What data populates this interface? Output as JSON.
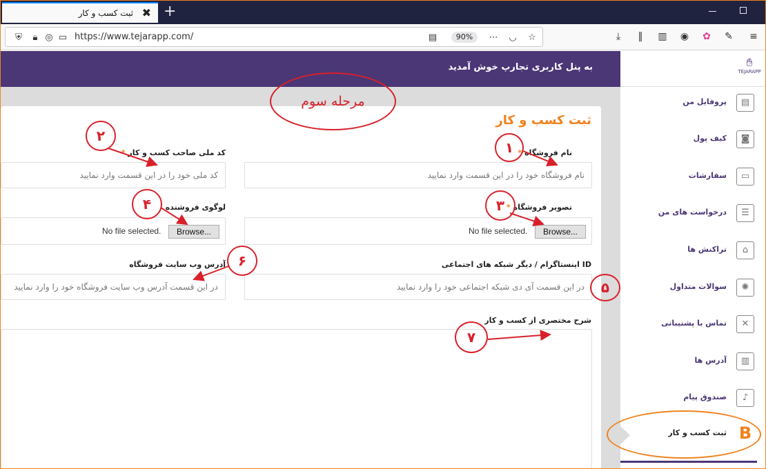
{
  "browser": {
    "tab_title": "ثبت کسب و کار",
    "tab_close": "✖",
    "new_tab": "+",
    "url": "https://www.tejarapp.com/",
    "zoom": "90%"
  },
  "header": {
    "welcome": "به پنل کاربری تجارپ خوش آمدید",
    "logo_text": "TEJARAPP"
  },
  "form": {
    "title": "ثبت کسب و کار",
    "required_mark": "*",
    "shop_name_label": "نام فروشگاه",
    "shop_name_placeholder": "نام فروشگاه خود را در این قسمت وارد نمایید",
    "national_code_label": "کد ملی صاحب کسب و کار",
    "national_code_placeholder": "کد ملی خود را در این قسمت وارد نمایید",
    "shop_image_label": "تصویر فروشگاه",
    "seller_logo_label": "لوگوی فروشنده",
    "browse_label": "Browse...",
    "no_file": "No file selected.",
    "social_label": "ID اینستاگرام / دیگر شبکه های اجتماعی",
    "social_placeholder": "در این قسمت آی دی شبکه اجتماعی خود را وارد نمایید",
    "website_label": "آدرس وب سایت فروشگاه",
    "website_placeholder": "در این قسمت آدرس وب سایت فروشگاه خود را وارد نمایید",
    "description_label": "شرح مختصری از کسب و کار"
  },
  "sidebar": {
    "items": [
      {
        "label": "پروفایل من",
        "icon": "id-card-icon",
        "glyph": "▤"
      },
      {
        "label": "کیف پول",
        "icon": "wallet-icon",
        "glyph": "◙"
      },
      {
        "label": "سفارشات",
        "icon": "box-icon",
        "glyph": "▭"
      },
      {
        "label": "درخواست های من",
        "icon": "list-icon",
        "glyph": "☰"
      },
      {
        "label": "تراکنش ها",
        "icon": "bank-icon",
        "glyph": "⌂"
      },
      {
        "label": "سوالات متداول",
        "icon": "bulb-icon",
        "glyph": "✺"
      },
      {
        "label": "تماس با پشتیبانی",
        "icon": "tools-icon",
        "glyph": "✕"
      },
      {
        "label": "آدرس ها",
        "icon": "map-icon",
        "glyph": "▥"
      },
      {
        "label": "صندوق پیام",
        "icon": "bell-icon",
        "glyph": "♪"
      },
      {
        "label": "ثبت کسب و کار",
        "icon": "business-b-icon",
        "glyph": "B"
      }
    ]
  },
  "annotations": {
    "stage": "مرحله سوم",
    "n1": "١",
    "n2": "٢",
    "n3": "٣",
    "n4": "۴",
    "n5": "۵",
    "n6": "۶",
    "n7": "٧"
  }
}
